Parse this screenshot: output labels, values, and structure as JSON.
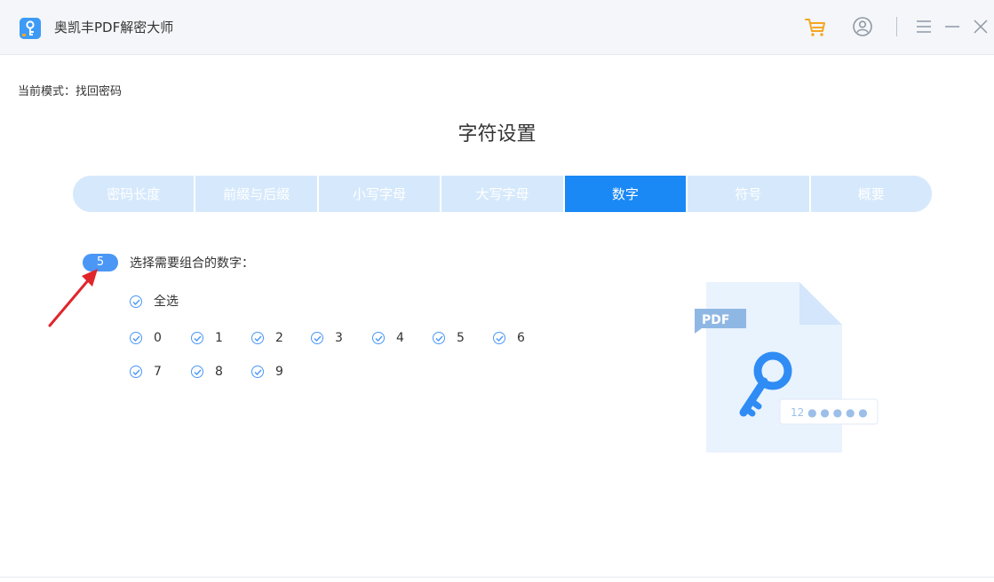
{
  "window": {
    "title": "奥凯丰PDF解密大师"
  },
  "titlebar": {
    "icons": [
      "cart-icon",
      "user-icon",
      "menu-icon",
      "minimize-icon",
      "close-icon"
    ],
    "accent_cart": "#f5a623",
    "icon_color": "#8f98a5"
  },
  "mode": {
    "label": "当前模式：找回密码"
  },
  "page": {
    "title": "字符设置"
  },
  "tabs": [
    {
      "label": "密码长度",
      "active": false
    },
    {
      "label": "前缀与后缀",
      "active": false
    },
    {
      "label": "小写字母",
      "active": false
    },
    {
      "label": "大写字母",
      "active": false
    },
    {
      "label": "数字",
      "active": true
    },
    {
      "label": "符号",
      "active": false
    },
    {
      "label": "概要",
      "active": false
    }
  ],
  "step": {
    "number": "5",
    "text": "选择需要组合的数字："
  },
  "checkboxes": {
    "select_all": {
      "label": "全选",
      "checked": true
    },
    "digits": [
      {
        "label": "0",
        "checked": true
      },
      {
        "label": "1",
        "checked": true
      },
      {
        "label": "2",
        "checked": true
      },
      {
        "label": "3",
        "checked": true
      },
      {
        "label": "4",
        "checked": true
      },
      {
        "label": "5",
        "checked": true
      },
      {
        "label": "6",
        "checked": true
      },
      {
        "label": "7",
        "checked": true
      },
      {
        "label": "8",
        "checked": true
      },
      {
        "label": "9",
        "checked": true
      }
    ]
  },
  "illustration": {
    "pdf_tag": "PDF",
    "password_hint": "12 ● ● ● ● ●"
  },
  "colors": {
    "accent": "#1a88f5",
    "tab_inactive": "#d6e9fc",
    "annotation_arrow": "#e0262b"
  }
}
